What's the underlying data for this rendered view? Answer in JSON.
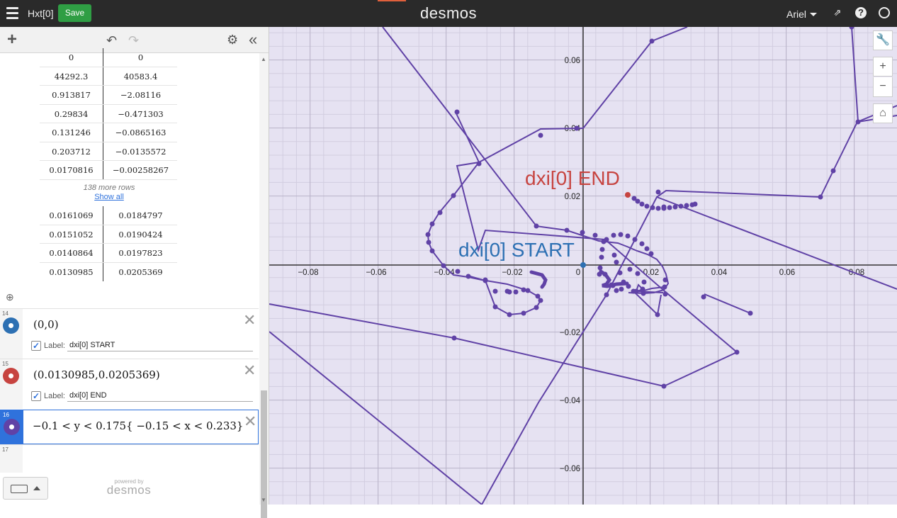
{
  "header": {
    "title": "Hxt[0]",
    "save_label": "Save",
    "brand": "desmos",
    "user": "Ariel"
  },
  "table": {
    "top_rows": [
      [
        "0",
        "0"
      ],
      [
        "44292.3",
        "40583.4"
      ],
      [
        "0.913817",
        "−2.08116"
      ],
      [
        "0.29834",
        "−0.471303"
      ],
      [
        "0.131246",
        "−0.0865163"
      ],
      [
        "0.203712",
        "−0.0135572"
      ],
      [
        "0.0170816",
        "−0.00258267"
      ]
    ],
    "more_rows": "138 more rows",
    "show_all": "Show all",
    "bottom_rows": [
      [
        "0.0161069",
        "0.0184797"
      ],
      [
        "0.0151052",
        "0.0190424"
      ],
      [
        "0.0140864",
        "0.0197823"
      ],
      [
        "0.0130985",
        "0.0205369"
      ]
    ]
  },
  "expressions": [
    {
      "num": "14",
      "latex": "(0,0)",
      "label_prefix": "Label:",
      "label": "dxi[0] START",
      "color": "#2d70b3"
    },
    {
      "num": "15",
      "latex": "(0.0130985,0.0205369)",
      "label_prefix": "Label:",
      "label": "dxi[0] END",
      "color": "#c74440"
    },
    {
      "num": "16",
      "latex": "−0.1 < y < 0.175{ −0.15 < x < 0.233}",
      "color": "#6042a6"
    },
    {
      "num": "17"
    }
  ],
  "footer": {
    "powered_by": "powered by",
    "brand": "desmos"
  },
  "graph": {
    "x_ticks": [
      "−0.08",
      "−0.06",
      "−0.04",
      "−0.02",
      "0",
      "0.02",
      "0.04",
      "0.06",
      "0.08"
    ],
    "y_ticks": [
      "0.06",
      "0.04",
      "0.02",
      "−0.02",
      "−0.04",
      "−0.06"
    ],
    "start_label": "dxi[0] START",
    "end_label": "dxi[0] END",
    "start_color": "#2d70b3",
    "end_color": "#c74440",
    "curve_color": "#6042a6",
    "shade_color": "#e6e2f2"
  }
}
